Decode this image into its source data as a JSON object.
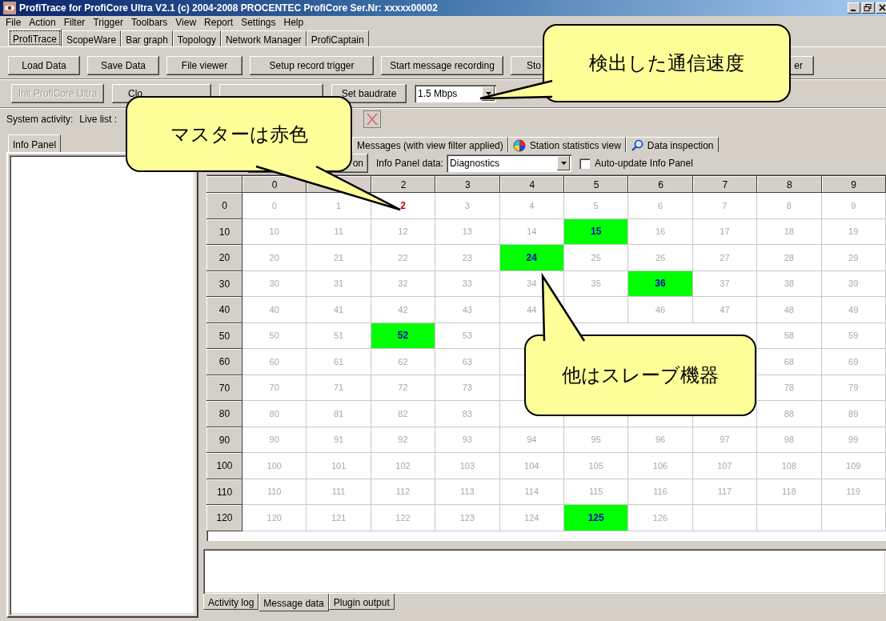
{
  "window": {
    "title": "ProfiTrace for ProfiCore Ultra V2.1 (c) 2004-2008 PROCENTEC  ProfiCore Ser.Nr: xxxxx00002"
  },
  "menu": [
    "File",
    "Action",
    "Filter",
    "Trigger",
    "Toolbars",
    "View",
    "Report",
    "Settings",
    "Help"
  ],
  "top_tabs": [
    {
      "label": "ProfiTrace",
      "selected": true
    },
    {
      "label": "ScopeWare",
      "selected": false
    },
    {
      "label": "Bar graph",
      "selected": false
    },
    {
      "label": "Topology",
      "selected": false
    },
    {
      "label": "Network Manager",
      "selected": false
    },
    {
      "label": "ProfiCaptain",
      "selected": false
    }
  ],
  "toolbar_1": [
    {
      "label": "Load Data",
      "kind": "full"
    },
    {
      "label": "Save Data",
      "kind": "full"
    },
    {
      "label": "File viewer",
      "kind": "full"
    },
    {
      "label": "Setup record trigger",
      "kind": "full"
    },
    {
      "label": "Start message recording",
      "kind": "full"
    },
    {
      "label": "Sto",
      "kind": "cut-end"
    },
    {
      "label": "er",
      "kind": "cut-start"
    }
  ],
  "toolbar_2": {
    "buttons": [
      {
        "label": "Init ProfiCore Ultra",
        "kind": "full",
        "disabled": true
      },
      {
        "label": "Clo",
        "kind": "cut-end",
        "disabled": false
      },
      {
        "kind": "covered"
      },
      {
        "label": "Set baudrate",
        "kind": "full",
        "disabled": false
      }
    ],
    "baudrate": {
      "value": "1.5 Mbps"
    }
  },
  "activity": {
    "system_label": "System activity:",
    "live_list_label": "Live list :"
  },
  "info_panel": {
    "tabs": [
      {
        "label": "Info Panel",
        "selected": true
      }
    ]
  },
  "view_tabs": [
    {
      "label": "Messages (with view filter applied)",
      "kind": "plain",
      "selected": false
    },
    {
      "label": "Station statistics view",
      "kind": "stats",
      "selected": false
    },
    {
      "label": "Data inspection",
      "kind": "inspect",
      "selected": false
    }
  ],
  "view_toolbar": {
    "button": {
      "label": "on"
    },
    "data_label": "Info Panel data:",
    "data_select": {
      "value": "Diagnostics"
    },
    "auto_update": {
      "label": "Auto-update Info Panel",
      "checked": false
    }
  },
  "live_list": {
    "columns": [
      {
        "label": "0",
        "kind": "header"
      },
      {
        "kind": "covered"
      },
      {
        "label": "2",
        "kind": "header"
      },
      {
        "label": "3",
        "kind": "header"
      },
      {
        "label": "4",
        "kind": "header"
      },
      {
        "label": "5",
        "kind": "header"
      },
      {
        "label": "6",
        "kind": "header"
      },
      {
        "label": "7",
        "kind": "header"
      },
      {
        "label": "8",
        "kind": "header"
      },
      {
        "label": "9",
        "kind": "header"
      }
    ],
    "rows": [
      {
        "label": "0",
        "cells": [
          {
            "text": "0",
            "kind": "idle"
          },
          {
            "text": "1",
            "kind": "idle"
          },
          {
            "text": "2",
            "kind": "master"
          },
          {
            "text": "3",
            "kind": "idle"
          },
          {
            "text": "4",
            "kind": "idle"
          },
          {
            "text": "5",
            "kind": "idle"
          },
          {
            "text": "6",
            "kind": "idle"
          },
          {
            "text": "7",
            "kind": "idle"
          },
          {
            "text": "8",
            "kind": "idle"
          },
          {
            "text": "9",
            "kind": "idle"
          }
        ]
      },
      {
        "label": "10",
        "cells": [
          {
            "text": "10",
            "kind": "idle"
          },
          {
            "text": "11",
            "kind": "idle"
          },
          {
            "text": "12",
            "kind": "idle"
          },
          {
            "text": "13",
            "kind": "idle"
          },
          {
            "text": "14",
            "kind": "idle"
          },
          {
            "text": "15",
            "kind": "slave"
          },
          {
            "text": "16",
            "kind": "idle"
          },
          {
            "text": "17",
            "kind": "idle"
          },
          {
            "text": "18",
            "kind": "idle"
          },
          {
            "text": "19",
            "kind": "idle"
          }
        ]
      },
      {
        "label": "20",
        "cells": [
          {
            "text": "20",
            "kind": "idle"
          },
          {
            "text": "21",
            "kind": "idle"
          },
          {
            "text": "22",
            "kind": "idle"
          },
          {
            "text": "23",
            "kind": "idle"
          },
          {
            "text": "24",
            "kind": "slave"
          },
          {
            "text": "25",
            "kind": "idle"
          },
          {
            "text": "26",
            "kind": "idle"
          },
          {
            "text": "27",
            "kind": "idle"
          },
          {
            "text": "28",
            "kind": "idle"
          },
          {
            "text": "29",
            "kind": "idle"
          }
        ]
      },
      {
        "label": "30",
        "cells": [
          {
            "text": "30",
            "kind": "idle"
          },
          {
            "text": "31",
            "kind": "idle"
          },
          {
            "text": "32",
            "kind": "idle"
          },
          {
            "text": "33",
            "kind": "idle"
          },
          {
            "text": "34",
            "kind": "idle"
          },
          {
            "text": "35",
            "kind": "idle"
          },
          {
            "text": "36",
            "kind": "slave"
          },
          {
            "text": "37",
            "kind": "idle"
          },
          {
            "text": "38",
            "kind": "idle"
          },
          {
            "text": "39",
            "kind": "idle"
          }
        ]
      },
      {
        "label": "40",
        "cells": [
          {
            "text": "40",
            "kind": "idle"
          },
          {
            "text": "41",
            "kind": "idle"
          },
          {
            "text": "42",
            "kind": "idle"
          },
          {
            "text": "43",
            "kind": "idle"
          },
          {
            "text": "44",
            "kind": "idle"
          },
          {
            "kind": "covered"
          },
          {
            "text": "46",
            "kind": "idle"
          },
          {
            "text": "47",
            "kind": "idle"
          },
          {
            "text": "48",
            "kind": "idle"
          },
          {
            "text": "49",
            "kind": "idle"
          }
        ]
      },
      {
        "label": "50",
        "cells": [
          {
            "text": "50",
            "kind": "idle"
          },
          {
            "text": "51",
            "kind": "idle"
          },
          {
            "text": "52",
            "kind": "slave"
          },
          {
            "text": "53",
            "kind": "idle"
          },
          {
            "kind": "covered"
          },
          {
            "kind": "hidden"
          },
          {
            "kind": "hidden"
          },
          {
            "kind": "covered"
          },
          {
            "text": "58",
            "kind": "idle"
          },
          {
            "text": "59",
            "kind": "idle"
          }
        ]
      },
      {
        "label": "60",
        "cells": [
          {
            "text": "60",
            "kind": "idle"
          },
          {
            "text": "61",
            "kind": "idle"
          },
          {
            "text": "62",
            "kind": "idle"
          },
          {
            "text": "63",
            "kind": "idle"
          },
          {
            "kind": "covered"
          },
          {
            "kind": "hidden"
          },
          {
            "kind": "covered"
          },
          {
            "kind": "covered"
          },
          {
            "text": "68",
            "kind": "idle"
          },
          {
            "text": "69",
            "kind": "idle"
          }
        ]
      },
      {
        "label": "70",
        "cells": [
          {
            "text": "70",
            "kind": "idle"
          },
          {
            "text": "71",
            "kind": "idle"
          },
          {
            "text": "72",
            "kind": "idle"
          },
          {
            "text": "73",
            "kind": "idle"
          },
          {
            "kind": "covered"
          },
          {
            "kind": "covered"
          },
          {
            "kind": "covered"
          },
          {
            "kind": "covered"
          },
          {
            "text": "78",
            "kind": "idle"
          },
          {
            "text": "79",
            "kind": "idle"
          }
        ]
      },
      {
        "label": "80",
        "cells": [
          {
            "text": "80",
            "kind": "idle"
          },
          {
            "text": "81",
            "kind": "idle"
          },
          {
            "text": "82",
            "kind": "idle"
          },
          {
            "text": "83",
            "kind": "idle"
          },
          {
            "kind": "covered"
          },
          {
            "kind": "covered"
          },
          {
            "kind": "covered"
          },
          {
            "kind": "covered"
          },
          {
            "text": "88",
            "kind": "idle"
          },
          {
            "text": "89",
            "kind": "idle"
          }
        ]
      },
      {
        "label": "90",
        "cells": [
          {
            "text": "90",
            "kind": "idle"
          },
          {
            "text": "91",
            "kind": "idle"
          },
          {
            "text": "92",
            "kind": "idle"
          },
          {
            "text": "93",
            "kind": "idle"
          },
          {
            "text": "94",
            "kind": "idle"
          },
          {
            "text": "95",
            "kind": "idle"
          },
          {
            "text": "96",
            "kind": "idle"
          },
          {
            "text": "97",
            "kind": "idle"
          },
          {
            "text": "98",
            "kind": "idle"
          },
          {
            "text": "99",
            "kind": "idle"
          }
        ]
      },
      {
        "label": "100",
        "cells": [
          {
            "text": "100",
            "kind": "idle"
          },
          {
            "text": "101",
            "kind": "idle"
          },
          {
            "text": "102",
            "kind": "idle"
          },
          {
            "text": "103",
            "kind": "idle"
          },
          {
            "text": "104",
            "kind": "idle"
          },
          {
            "text": "105",
            "kind": "idle"
          },
          {
            "text": "106",
            "kind": "idle"
          },
          {
            "text": "107",
            "kind": "idle"
          },
          {
            "text": "108",
            "kind": "idle"
          },
          {
            "text": "109",
            "kind": "idle"
          }
        ]
      },
      {
        "label": "110",
        "cells": [
          {
            "text": "110",
            "kind": "idle"
          },
          {
            "text": "111",
            "kind": "idle"
          },
          {
            "text": "112",
            "kind": "idle"
          },
          {
            "text": "113",
            "kind": "idle"
          },
          {
            "text": "114",
            "kind": "idle"
          },
          {
            "text": "115",
            "kind": "idle"
          },
          {
            "text": "116",
            "kind": "idle"
          },
          {
            "text": "117",
            "kind": "idle"
          },
          {
            "text": "118",
            "kind": "idle"
          },
          {
            "text": "119",
            "kind": "idle"
          }
        ]
      },
      {
        "label": "120",
        "cells": [
          {
            "text": "120",
            "kind": "idle"
          },
          {
            "text": "121",
            "kind": "idle"
          },
          {
            "text": "122",
            "kind": "idle"
          },
          {
            "text": "123",
            "kind": "idle"
          },
          {
            "text": "124",
            "kind": "idle"
          },
          {
            "text": "125",
            "kind": "slave"
          },
          {
            "text": "126",
            "kind": "idle"
          },
          {
            "kind": "empty"
          },
          {
            "kind": "empty"
          },
          {
            "kind": "empty"
          }
        ]
      }
    ]
  },
  "bottom_tabs": [
    {
      "label": "Activity log",
      "selected": false
    },
    {
      "label": "Message data",
      "selected": true
    },
    {
      "label": "Plugin output",
      "selected": false
    }
  ],
  "callouts": [
    {
      "text": "検出した通信速度",
      "kind": "speed"
    },
    {
      "text": "マスターは赤色",
      "kind": "master"
    },
    {
      "text": "他はスレーブ機器",
      "kind": "slave"
    }
  ]
}
